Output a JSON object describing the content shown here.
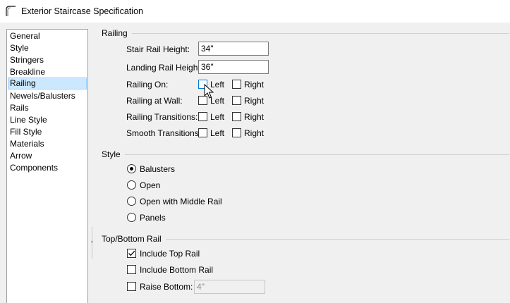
{
  "window": {
    "title": "Exterior Staircase Specification"
  },
  "sidebar": {
    "items": [
      {
        "label": "General",
        "selected": false
      },
      {
        "label": "Style",
        "selected": false
      },
      {
        "label": "Stringers",
        "selected": false
      },
      {
        "label": "Breakline",
        "selected": false
      },
      {
        "label": "Railing",
        "selected": true
      },
      {
        "label": "Newels/Balusters",
        "selected": false
      },
      {
        "label": "Rails",
        "selected": false
      },
      {
        "label": "Line Style",
        "selected": false
      },
      {
        "label": "Fill Style",
        "selected": false
      },
      {
        "label": "Materials",
        "selected": false
      },
      {
        "label": "Arrow",
        "selected": false
      },
      {
        "label": "Components",
        "selected": false
      }
    ]
  },
  "railing": {
    "section_label": "Railing",
    "stair_rail_height": {
      "label": "Stair Rail Height:",
      "value": "34\""
    },
    "landing_rail_height": {
      "label": "Landing Rail Height:",
      "value": "36\""
    },
    "rows": [
      {
        "label": "Railing On:",
        "left": false,
        "right": false
      },
      {
        "label": "Railing at Wall:",
        "left": false,
        "right": false
      },
      {
        "label": "Railing Transitions:",
        "left": false,
        "right": false
      },
      {
        "label": "Smooth Transitions:",
        "left": false,
        "right": false
      }
    ],
    "left_label": "Left",
    "right_label": "Right"
  },
  "style": {
    "section_label": "Style",
    "options": [
      {
        "label": "Balusters",
        "selected": true
      },
      {
        "label": "Open",
        "selected": false
      },
      {
        "label": "Open with Middle Rail",
        "selected": false
      },
      {
        "label": "Panels",
        "selected": false
      }
    ]
  },
  "top_bottom_rail": {
    "section_label": "Top/Bottom Rail",
    "include_top_rail": {
      "label": "Include Top Rail",
      "checked": true
    },
    "include_bottom_rail": {
      "label": "Include Bottom Rail",
      "checked": false
    },
    "raise_bottom": {
      "label": "Raise Bottom:",
      "checked": false,
      "value": "4\""
    }
  },
  "colors": {
    "selection_bg": "#cce8ff",
    "selection_border": "#99d1ff",
    "hover_border": "#0078d7"
  }
}
